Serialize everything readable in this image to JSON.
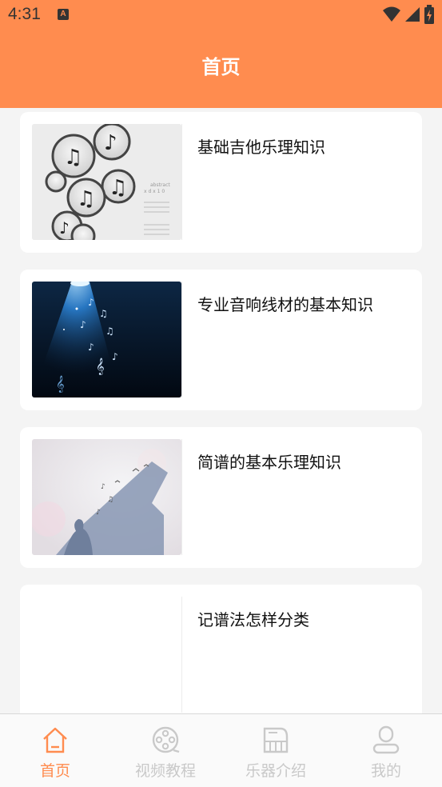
{
  "status_bar": {
    "time": "4:31",
    "notification": "A"
  },
  "header": {
    "title": "首页"
  },
  "articles": [
    {
      "title": "基础吉他乐理知识",
      "image": "music-notes-circles"
    },
    {
      "title": "专业音响线材的基本知识",
      "image": "blue-spotlight-notes"
    },
    {
      "title": "简谱的基本乐理知识",
      "image": "piano-silhouette"
    },
    {
      "title": "记谱法怎样分类",
      "image": "blank"
    }
  ],
  "tabs": [
    {
      "label": "首页",
      "icon": "home-icon",
      "active": true
    },
    {
      "label": "视频教程",
      "icon": "film-reel-icon",
      "active": false
    },
    {
      "label": "乐器介绍",
      "icon": "piano-icon",
      "active": false
    },
    {
      "label": "我的",
      "icon": "user-icon",
      "active": false
    }
  ],
  "colors": {
    "accent": "#ff8c4f",
    "inactive": "#c9c9c9",
    "background": "#f4f4f4"
  }
}
